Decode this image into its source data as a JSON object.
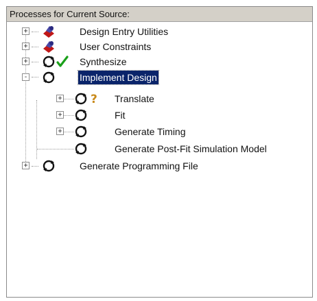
{
  "panel": {
    "title": "Processes for Current Source:"
  },
  "tree": [
    {
      "label": "Design Entry Utilities",
      "icon": "process-icon-red",
      "status": null,
      "expander": "+",
      "depth": 0
    },
    {
      "label": "User Constraints",
      "icon": "process-icon-red",
      "status": null,
      "expander": "+",
      "depth": 0
    },
    {
      "label": "Synthesize",
      "icon": "process-cycle-icon",
      "status": "checkmark-icon",
      "expander": "+",
      "depth": 0
    },
    {
      "label": "Implement Design",
      "icon": "process-cycle-icon",
      "status": null,
      "expander": "-",
      "depth": 0,
      "selected": true
    },
    {
      "label": "Translate",
      "icon": "process-cycle-icon",
      "status": "question-icon",
      "expander": "+",
      "depth": 1
    },
    {
      "label": "Fit",
      "icon": "process-cycle-icon",
      "status": null,
      "expander": "+",
      "depth": 1
    },
    {
      "label": "Generate Timing",
      "icon": "process-cycle-icon",
      "status": null,
      "expander": "+",
      "depth": 1
    },
    {
      "label": "Generate Post-Fit Simulation Model",
      "icon": "process-cycle-icon",
      "status": null,
      "expander": null,
      "depth": 1
    },
    {
      "label": "Generate Programming File",
      "icon": "process-cycle-icon",
      "status": null,
      "expander": "+",
      "depth": 0
    }
  ],
  "colors": {
    "selection": "#0a246a",
    "check": "#1aa01a",
    "question": "#c98a1a",
    "red_icon": "#c01818"
  }
}
